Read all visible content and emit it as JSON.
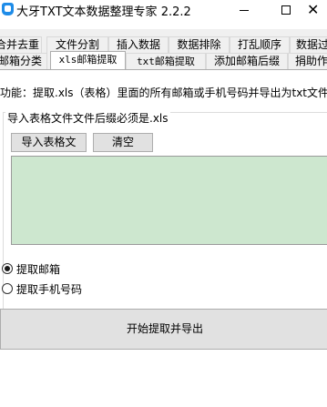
{
  "window": {
    "title": "大牙TXT文本数据整理专家 2.2.2",
    "minimize": "",
    "maximize": "",
    "close": "✕"
  },
  "tabs_row1": [
    "合并去重",
    "文件分割",
    "插入数据",
    "数据排除",
    "打乱顺序",
    "数据过"
  ],
  "tabs_row2": [
    "邮箱分类",
    "xls邮箱提取",
    "txt邮箱提取",
    "添加邮箱后缀",
    "捐助作"
  ],
  "function_description": "功能：提取.xls（表格）里面的所有邮箱或手机号码并导出为txt文件",
  "group": {
    "title": "导入表格文件文件后缀必须是.xls",
    "import_button": "导入表格文",
    "clear_button": "清空",
    "textarea_value": ""
  },
  "options": {
    "extract_email": "提取邮箱",
    "extract_phone": "提取手机号码",
    "selected": "extract_email"
  },
  "start_button": "开始提取并导出",
  "colors": {
    "textarea_bg": "#cde7cf",
    "button_bg": "#e1e1e1",
    "app_icon": "#1e8ce8"
  }
}
